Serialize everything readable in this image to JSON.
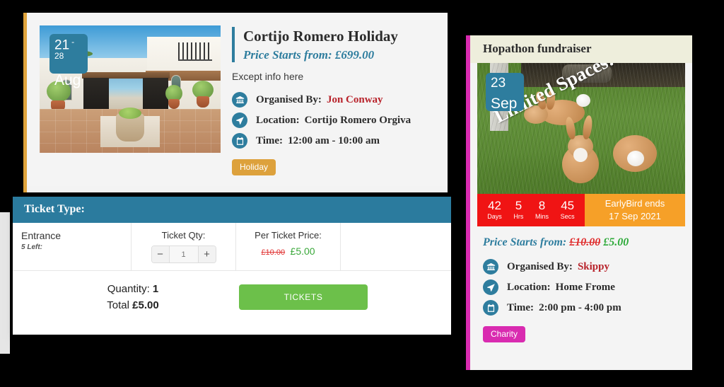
{
  "page": {
    "background_color": "#000000"
  },
  "event_card": {
    "accent_color": "#e0a43c",
    "date_badge": {
      "day": "21",
      "day_end": "-28",
      "month": "Aug"
    },
    "photo_alt": "villa-courtyard-photo",
    "title": "Cortijo Romero Holiday",
    "price_line": "Price Starts from: £699.00",
    "description": "Except info here",
    "meta": [
      {
        "icon": "bank-icon",
        "label": "Organised By:",
        "value": "Jon Conway",
        "value_color": "#b8232b"
      },
      {
        "icon": "location-icon",
        "label": "Location:",
        "value": "Cortijo Romero Orgiva",
        "value_color": "#2b2b2b"
      },
      {
        "icon": "calendar-icon",
        "label": "Time:",
        "value": "12:00 am - 10:00 am",
        "value_color": "#2b2b2b"
      }
    ],
    "tag": "Holiday",
    "tag_color": "#dda13c"
  },
  "ticket_panel": {
    "header": "Ticket Type:",
    "header_color": "#2b7b9e",
    "columns": [
      "",
      "Ticket Qty:",
      "Per Ticket Price:",
      ""
    ],
    "row": {
      "name": "Entrance",
      "left": "5 Left:",
      "qty_label": "Ticket Qty:",
      "qty_value": "1",
      "minus": "−",
      "plus": "+",
      "price_label": "Per Ticket Price:",
      "price_old": "£10.00",
      "price_new": "£5.00"
    },
    "summary": {
      "quantity_label": "Quantity:",
      "quantity_value": "1",
      "total_label": "Total",
      "total_value": "£5.00"
    },
    "button": "TICKETS",
    "button_color": "#6cc04a"
  },
  "fundraiser_card": {
    "accent_color": "#d92bb0",
    "header": "Hopathon fundraiser",
    "header_bg": "#eeeedc",
    "date_badge": {
      "day": "23",
      "month": "Sep"
    },
    "photo_alt": "rabbits-in-grass-photo",
    "overlay_text": "Limited Spaces!",
    "countdown": {
      "bg_color": "#f01414",
      "units": [
        {
          "value": "42",
          "label": "Days"
        },
        {
          "value": "5",
          "label": "Hrs"
        },
        {
          "value": "8",
          "label": "Mins"
        },
        {
          "value": "45",
          "label": "Secs"
        }
      ],
      "promo_line1": "EarlyBird ends",
      "promo_line2": "17 Sep 2021",
      "promo_color": "#f6a028"
    },
    "price_prefix": "Price Starts from:",
    "price_old": "£10.00",
    "price_new": "£5.00",
    "meta": [
      {
        "icon": "bank-icon",
        "label": "Organised By:",
        "value": "Skippy",
        "value_color": "#b8232b"
      },
      {
        "icon": "location-icon",
        "label": "Location:",
        "value": "Home Frome",
        "value_color": "#2b2b2b"
      },
      {
        "icon": "calendar-icon",
        "label": "Time:",
        "value": "2:00 pm - 4:00 pm",
        "value_color": "#2b2b2b"
      }
    ],
    "tag": "Charity",
    "tag_color": "#d92bb0"
  }
}
